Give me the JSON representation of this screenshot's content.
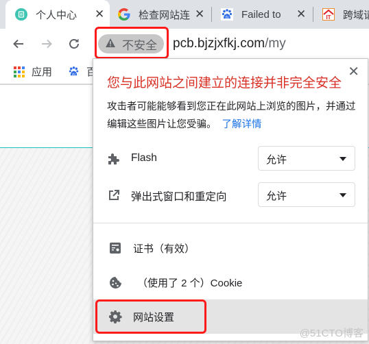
{
  "tabs": [
    {
      "title": "个人中心",
      "icon": "page-app-icon",
      "active": true
    },
    {
      "title": "检查网站连",
      "icon": "google-icon",
      "active": false
    },
    {
      "title": "Failed to",
      "icon": "baidu-icon",
      "active": false
    },
    {
      "title": "跨域请",
      "icon": "it-site-icon",
      "active": false
    }
  ],
  "toolbar": {
    "back": "back-arrow-icon",
    "forward": "forward-arrow-icon",
    "reload": "reload-icon",
    "security_label": "不安全",
    "url_host": "pcb.bjzjxfkj.com",
    "url_path": "/my"
  },
  "bookmarks": [
    {
      "label": "应用",
      "icon": "apps-grid-icon"
    },
    {
      "label": "百",
      "icon": "baidu-icon"
    }
  ],
  "popup": {
    "title": "您与此网站之间建立的连接并非完全安全",
    "description": "攻击者可能能够看到您正在此网站上浏览的图片，并通过编辑这些图片让您受骗。",
    "learn_more": "了解详情",
    "permissions": [
      {
        "label": "Flash",
        "icon": "puzzle-icon",
        "value": "允许"
      },
      {
        "label": "弹出式窗口和重定向",
        "icon": "external-link-icon",
        "value": "允许"
      }
    ],
    "certificate": "证书（有效）",
    "cookies": "（使用了 2 个）Cookie",
    "site_settings": "网站设置"
  },
  "colors": {
    "warning_title": "#d93025",
    "link": "#1a73e8",
    "annotation_red": "#ff1a1a",
    "teal_line": "#16c0c0"
  },
  "watermark": "@51CTO博客"
}
